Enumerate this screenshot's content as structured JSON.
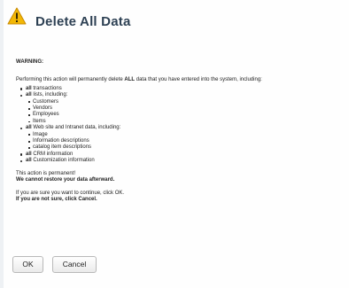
{
  "dialog": {
    "title": "Delete All Data",
    "icon": "warning-triangle-icon",
    "icon_color": "#f2b705"
  },
  "warning_heading": "WARNING:",
  "intro": {
    "pre": "Performing this action will permanently delete ",
    "bold": "ALL",
    "post": " data that you have entered into the system, including:"
  },
  "items": [
    {
      "bold": "all",
      "text": " transactions"
    },
    {
      "bold": "all",
      "text": " lists, including:",
      "sub": [
        "Customers",
        "Vendors",
        "Employees",
        "Items"
      ]
    },
    {
      "bold": "all",
      "text": " Web site and Intranet data, including:",
      "sub": [
        "Image",
        "Information descriptions",
        "catalog item descriptions"
      ]
    },
    {
      "bold": "all",
      "text": " CRM information"
    },
    {
      "bold": "all",
      "text": " Customization information"
    }
  ],
  "permanent_line": "This action is permanent!",
  "cannot_restore": "We cannot restore your data afterward.",
  "continue_line": "If you are sure you want to continue, click OK.",
  "not_sure_line": "If you are not sure, click Cancel.",
  "buttons": {
    "ok": "OK",
    "cancel": "Cancel"
  }
}
